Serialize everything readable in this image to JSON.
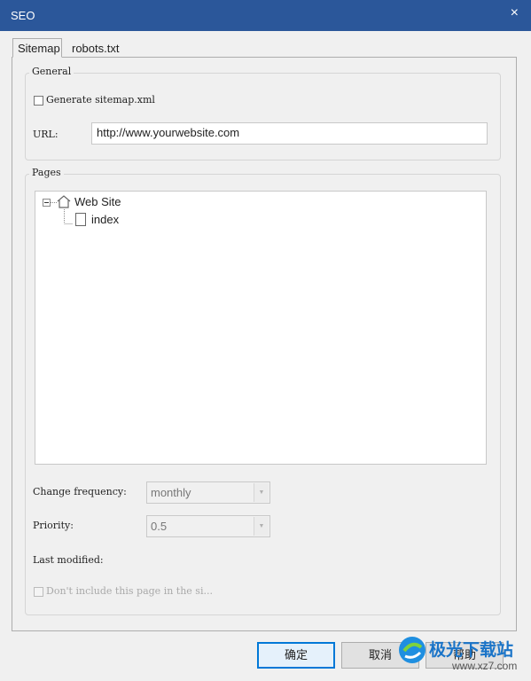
{
  "window": {
    "title": "SEO",
    "close_glyph": "×"
  },
  "tabs": [
    {
      "label": "Sitemap",
      "active": true
    },
    {
      "label": "robots.txt",
      "active": false
    }
  ],
  "general": {
    "caption": "General",
    "generate_sitemap_label": "Generate sitemap.xml",
    "generate_sitemap_checked": false,
    "url_label": "URL:",
    "url_value": "http://www.yourwebsite.com"
  },
  "pages": {
    "caption": "Pages",
    "tree": {
      "root": {
        "label": "Web Site",
        "expanded": true,
        "icon": "home-icon"
      },
      "children": [
        {
          "label": "index",
          "icon": "page-icon"
        }
      ]
    },
    "change_frequency_label": "Change frequency:",
    "change_frequency_value": "monthly",
    "priority_label": "Priority:",
    "priority_value": "0.5",
    "last_modified_label": "Last modified:",
    "exclude_label": "Don't include this page in the si...",
    "exclude_checked": false
  },
  "footer": {
    "ok_label": "确定",
    "cancel_label": "取消",
    "help_label": "帮助"
  },
  "watermark": {
    "text": "极光下载站",
    "url": "www.xz7.com"
  }
}
